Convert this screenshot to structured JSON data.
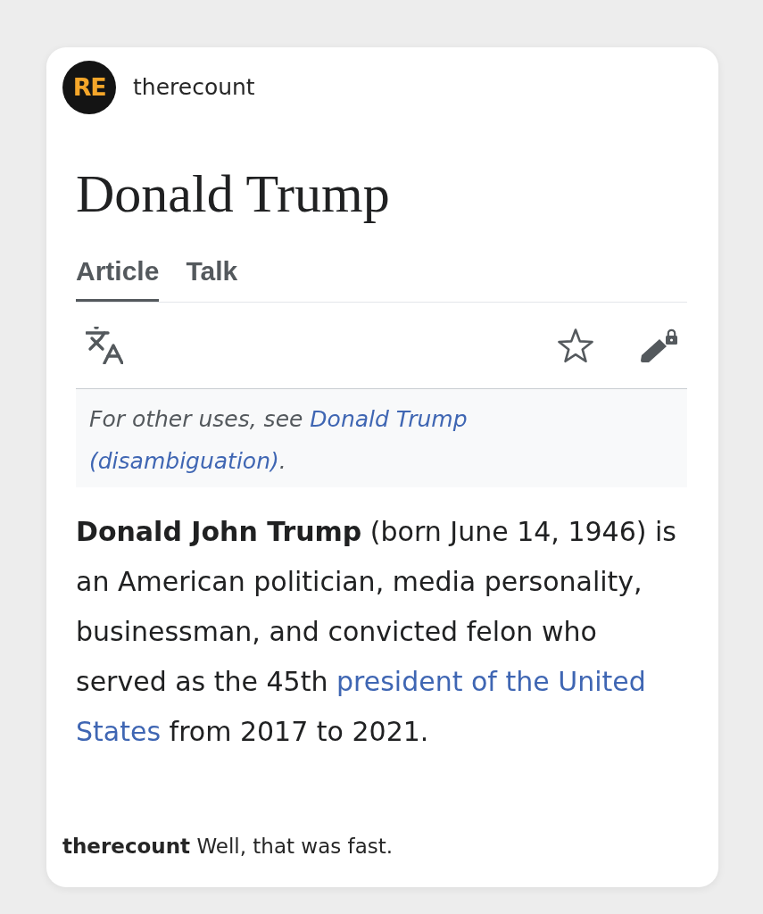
{
  "post": {
    "account": "therecount",
    "avatar": {
      "text": "RE"
    }
  },
  "article": {
    "title": "Donald Trump",
    "tabs": [
      {
        "label": "Article",
        "selected": true
      },
      {
        "label": "Talk",
        "selected": false
      }
    ],
    "hatnote": {
      "text": "For other uses, see ",
      "link": [
        "Donald Trump",
        "(disambiguation)"
      ],
      "suffix": "."
    },
    "lead": {
      "text": "**Donald John Trump** (born June 14, 1946) is an American politician, media personality, businessman, and convicted felon who served as the 45th ",
      "link": [
        "president of the United",
        "States"
      ],
      "suffix": " from 2017 to 2021."
    }
  },
  "caption": "**therecount** Well, that was fast."
}
